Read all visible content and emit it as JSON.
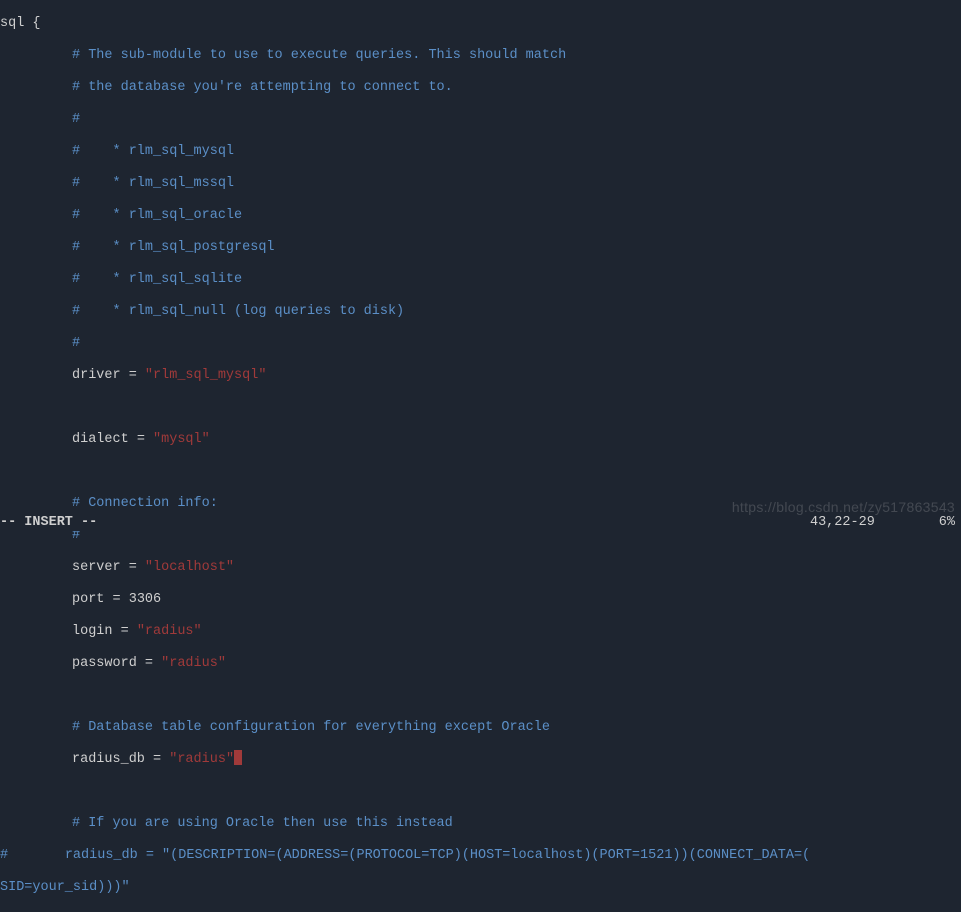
{
  "lines": {
    "l1": "sql {",
    "l2": "# The sub-module to use to execute queries. This should match",
    "l3": "# the database you're attempting to connect to.",
    "l4": "#",
    "l5": "#    * rlm_sql_mysql",
    "l6": "#    * rlm_sql_mssql",
    "l7": "#    * rlm_sql_oracle",
    "l8": "#    * rlm_sql_postgresql",
    "l9": "#    * rlm_sql_sqlite",
    "l10": "#    * rlm_sql_null (log queries to disk)",
    "l11": "#",
    "k_driver": "driver",
    "v_driver": "\"rlm_sql_mysql\"",
    "k_dialect": "dialect",
    "v_dialect": "\"mysql\"",
    "c_conn1": "# Connection info:",
    "c_conn2": "#",
    "k_server": "server",
    "v_server": "\"localhost\"",
    "k_port": "port",
    "v_port": "3306",
    "k_login": "login",
    "v_login": "\"radius\"",
    "k_password": "password",
    "v_password": "\"radius\"",
    "c_db": "# Database table configuration for everything except Oracle",
    "k_radius_db": "radius_db",
    "v_radius_db": "\"radius\"",
    "c_oracle": "# If you are using Oracle then use this instead",
    "commented_hash": "#",
    "commented_key": "radius_db = \"(DESCRIPTION=(ADDRESS=(PROTOCOL=TCP)(HOST=localhost)(PORT=1521))(CONNECT_DATA=(",
    "commented_cont": "SID=your_sid)))\""
  },
  "status": {
    "mode": "-- INSERT --",
    "position": "43,22-29",
    "percent": "6%"
  },
  "watermark": "https://blog.csdn.net/zy517863543"
}
